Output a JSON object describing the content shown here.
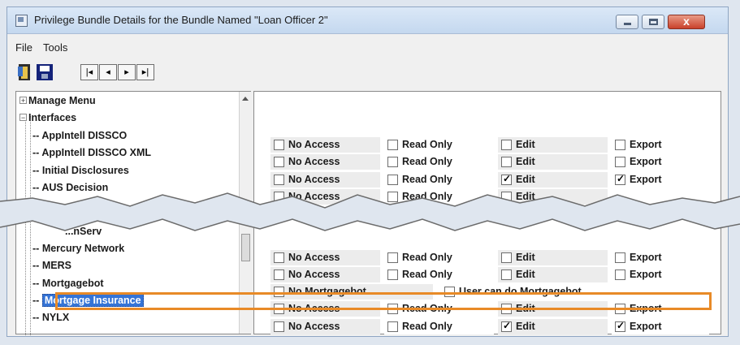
{
  "window": {
    "title": "Privilege Bundle Details for the Bundle Named \"Loan Officer 2\"",
    "close_glyph": "x"
  },
  "menu": [
    "File",
    "Tools"
  ],
  "toolbar": {
    "buttons": [
      "exit-icon",
      "save-icon"
    ],
    "nav": [
      "|◂",
      "◂",
      "▸",
      "▸|"
    ]
  },
  "tree": [
    {
      "label": "Manage Menu",
      "expander": "+"
    },
    {
      "label": "Interfaces",
      "expander": "−"
    },
    {
      "label": "AppIntell DISSCO"
    },
    {
      "label": "AppIntell DISSCO XML"
    },
    {
      "label": "Initial Disclosures"
    },
    {
      "label": "AUS Decision"
    },
    {
      "label": "...nServ"
    },
    {
      "label": "Mercury Network"
    },
    {
      "label": "MERS"
    },
    {
      "label": "Mortgagebot"
    },
    {
      "label": "Mortgage Insurance",
      "selected": true
    },
    {
      "label": "NYLX"
    }
  ],
  "permissions": [
    {
      "row": 2,
      "cells": [
        {
          "label": "No Access",
          "checked": false
        },
        {
          "label": "Read Only",
          "checked": false
        },
        {
          "label": "Edit",
          "checked": false
        },
        {
          "label": "Export",
          "checked": false
        }
      ]
    },
    {
      "row": 3,
      "cells": [
        {
          "label": "No Access",
          "checked": false
        },
        {
          "label": "Read Only",
          "checked": false
        },
        {
          "label": "Edit",
          "checked": false
        },
        {
          "label": "Export",
          "checked": false
        }
      ]
    },
    {
      "row": 4,
      "cells": [
        {
          "label": "No Access",
          "checked": false
        },
        {
          "label": "Read Only",
          "checked": false
        },
        {
          "label": "Edit",
          "checked": true
        },
        {
          "label": "Export",
          "checked": true
        }
      ]
    },
    {
      "row": 5,
      "cells": [
        {
          "label": "No Access",
          "checked": false
        },
        {
          "label": "Read Only",
          "checked": false
        },
        {
          "label": "Edit",
          "checked": false
        }
      ]
    },
    {
      "row": 7,
      "cells": [
        {
          "label": "No Access",
          "checked": false
        },
        {
          "label": "Read Only",
          "checked": false
        },
        {
          "label": "Edit",
          "checked": false
        },
        {
          "label": "Export",
          "checked": false
        }
      ]
    },
    {
      "row": 8,
      "cells": [
        {
          "label": "No Access",
          "checked": false
        },
        {
          "label": "Read Only",
          "checked": false
        },
        {
          "label": "Edit",
          "checked": false
        },
        {
          "label": "Export",
          "checked": false
        }
      ]
    },
    {
      "row": 9,
      "cells": [
        {
          "label": "No Mortgagebot",
          "checked": false
        },
        {
          "label": "User can do Mortgagebot",
          "checked": false
        }
      ]
    },
    {
      "row": 10,
      "cells": [
        {
          "label": "No Access",
          "checked": false
        },
        {
          "label": "Read Only",
          "checked": false
        },
        {
          "label": "Edit",
          "checked": false
        },
        {
          "label": "Export",
          "checked": false
        }
      ]
    },
    {
      "row": 11,
      "cells": [
        {
          "label": "No Access",
          "checked": false
        },
        {
          "label": "Read Only",
          "checked": false
        },
        {
          "label": "Edit",
          "checked": true
        },
        {
          "label": "Export",
          "checked": true
        }
      ]
    }
  ],
  "colors": {
    "selection": "#3574d6",
    "highlight": "#e88a27"
  }
}
